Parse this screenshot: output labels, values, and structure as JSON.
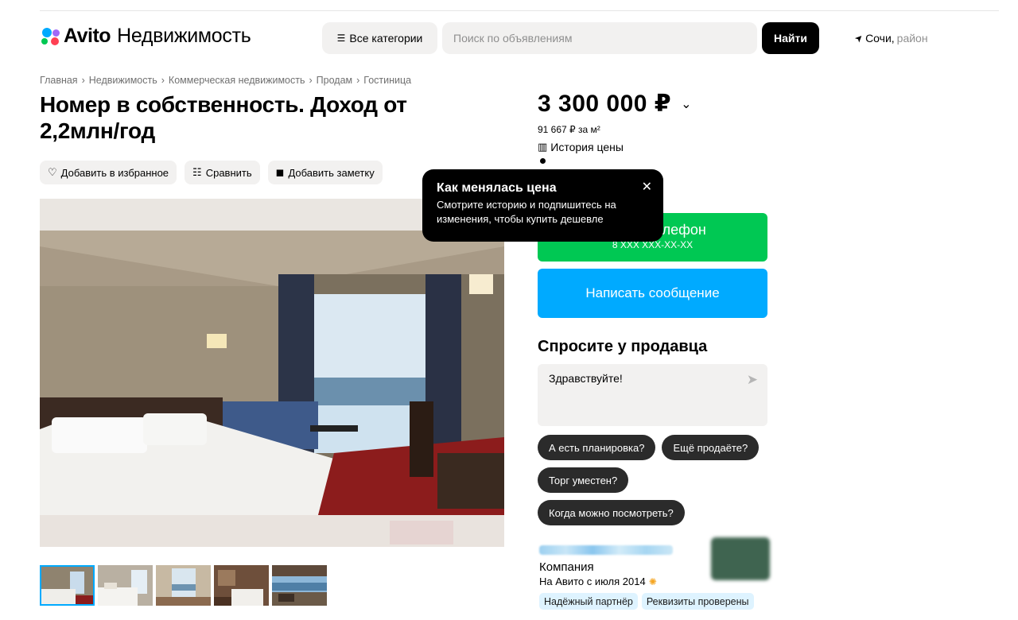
{
  "header": {
    "logo_brand": "Avito",
    "logo_section": "Недвижимость",
    "categories_label": "Все категории",
    "search_placeholder": "Поиск по объявлениям",
    "search_button": "Найти",
    "location_city": "Сочи,",
    "location_district": "район"
  },
  "breadcrumbs": [
    "Главная",
    "Недвижимость",
    "Коммерческая недвижимость",
    "Продам",
    "Гостиница"
  ],
  "listing": {
    "title": "Номер в собственность. Доход от 2,2млн/год",
    "actions": {
      "favorite": "Добавить в избранное",
      "compare": "Сравнить",
      "note": "Добавить заметку"
    },
    "photo_count": 5,
    "active_photo": 1
  },
  "price": {
    "value": "3 300 000 ₽",
    "per_meter": "91 667 ₽ за м²",
    "history_link": "История цены"
  },
  "tooltip": {
    "title": "Как менялась цена",
    "body": "Смотрите историю и подпишитесь на изменения, чтобы купить дешевле"
  },
  "contact": {
    "phone_label": "елефон",
    "phone_number": "8 XXX XXX-XX-XX",
    "message_button": "Написать сообщение"
  },
  "ask_seller": {
    "title": "Спросите у продавца",
    "message_value": "Здравствуйте!",
    "quick_questions": [
      "А есть планировка?",
      "Ещё продаёте?",
      "Торг уместен?",
      "Когда можно посмотреть?"
    ]
  },
  "seller": {
    "type": "Компания",
    "since": "На Авито с июля 2014",
    "badges": [
      "Надёжный партнёр",
      "Реквизиты проверены"
    ]
  },
  "colors": {
    "green": "#00c853",
    "blue": "#00aaff",
    "chip": "#2b2b2b",
    "badge": "#def3ff"
  }
}
